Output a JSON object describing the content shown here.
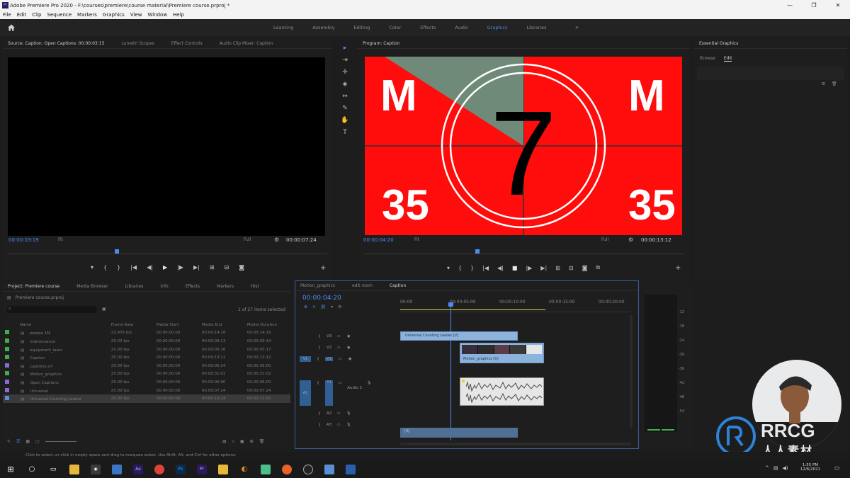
{
  "window": {
    "title": "Adobe Premiere Pro 2020 - F:\\courses\\premiere\\course material\\Premiere course.prproj *",
    "controls": [
      "—",
      "❐",
      "✕"
    ]
  },
  "menu": [
    "File",
    "Edit",
    "Clip",
    "Sequence",
    "Markers",
    "Graphics",
    "View",
    "Window",
    "Help"
  ],
  "workspaces": {
    "tabs": [
      "Learning",
      "Assembly",
      "Editing",
      "Color",
      "Effects",
      "Audio",
      "Graphics",
      "Libraries"
    ],
    "active": "Graphics",
    "more": "»"
  },
  "source_panel": {
    "tabs": [
      "Source: Caption: Open Captions: 00:00:03:15",
      "Lumetri Scopes",
      "Effect Controls",
      "Audio Clip Mixer: Caption"
    ],
    "timecode_in": "00:00:03:19",
    "fit": "Fit",
    "quality": "Full",
    "timecode_out": "00:00:07:24"
  },
  "program_panel": {
    "title": "Program: Caption",
    "timecode_in": "00:00:04:20",
    "fit": "Fit",
    "quality": "Full",
    "timecode_out": "00:00:13:12",
    "leader": {
      "letter_left": "M",
      "letter_right": "M",
      "num_left": "35",
      "num_right": "35",
      "count": "7"
    }
  },
  "essential_graphics": {
    "title": "Essential Graphics",
    "tabs": [
      "Browse",
      "Edit"
    ],
    "active": "Edit"
  },
  "project_panel": {
    "tabs": [
      "Project: Premiere course",
      "Media Browser",
      "Libraries",
      "Info",
      "Effects",
      "Markers",
      "Hist"
    ],
    "path": "Premiere course.prproj",
    "count": "1 of 27 items selected",
    "columns": [
      "Name",
      "Frame Rate",
      "Media Start",
      "Media End",
      "Media Duration"
    ],
    "rows": [
      {
        "color": "#3fae49",
        "name": "people 1M",
        "fr": "23.976 fps",
        "start": "00:00:00:00",
        "end": "00:00:14:18",
        "dur": "00:00:14:19"
      },
      {
        "color": "#3fae49",
        "name": "maintenance",
        "fr": "25.00 fps",
        "start": "00:00:00:00",
        "end": "00:00:09:13",
        "dur": "00:00:09:14"
      },
      {
        "color": "#3fae49",
        "name": "equipment_lawn",
        "fr": "25.00 fps",
        "start": "00:00:00:00",
        "end": "00:00:05:16",
        "dur": "00:00:05:17"
      },
      {
        "color": "#3fae49",
        "name": "Caption",
        "fr": "25.00 fps",
        "start": "00:00:00:00",
        "end": "00:00:13:11",
        "dur": "00:00:13:12"
      },
      {
        "color": "#8a6bd6",
        "name": "captions.srt",
        "fr": "25.00 fps",
        "start": "00:00:00:00",
        "end": "00:00:06:24",
        "dur": "00:00:06:00"
      },
      {
        "color": "#3fae49",
        "name": "Motion_graphics",
        "fr": "25.00 fps",
        "start": "00:00:00:00",
        "end": "00:00:31:01",
        "dur": "00:00:31:02"
      },
      {
        "color": "#8a6bd6",
        "name": "Open Captions",
        "fr": "25.00 fps",
        "start": "00:00:00:00",
        "end": "00:00:06:00",
        "dur": "00:00:06:00"
      },
      {
        "color": "#8a6bd6",
        "name": "Universal",
        "fr": "25.00 fps",
        "start": "00:00:00:00",
        "end": "00:00:07:24",
        "dur": "00:00:07:24"
      },
      {
        "color": "#5b8fd6",
        "name": "Universal Counting Leader",
        "fr": "25.00 fps",
        "start": "00:00:00:00",
        "end": "00:00:10:24",
        "dur": "00:00:11:00",
        "selected": true
      }
    ]
  },
  "timeline": {
    "tabs": [
      "Motion_graphics",
      "edit room",
      "Caption"
    ],
    "active": "Caption",
    "timecode": "00:00:04:20",
    "ruler": [
      "00:00",
      "00:00:05:00",
      "00:00:10:00",
      "00:00:15:00",
      "00:00:20:00"
    ],
    "video_tracks": [
      "V3",
      "V2",
      "V1"
    ],
    "audio_tracks": [
      "A1",
      "A2",
      "A3"
    ],
    "audio_name": "Audio 1",
    "clips": {
      "v3": "Universal Counting Leader [V]",
      "v2": "Motion_graphics [V]",
      "a3": "[A]"
    }
  },
  "meter": {
    "values": [
      "-12",
      "-18",
      "-24",
      "-30",
      "-36",
      "-42",
      "-48",
      "-54"
    ]
  },
  "status_text": "Click to select, or click in empty space and drag to marquee select. Use Shift, Alt, and Ctrl for other options.",
  "taskbar": {
    "time": "1:55 PM",
    "date": "12/6/2021"
  },
  "watermarks": {
    "brand": "RRCG",
    "cn": "人人素材"
  }
}
